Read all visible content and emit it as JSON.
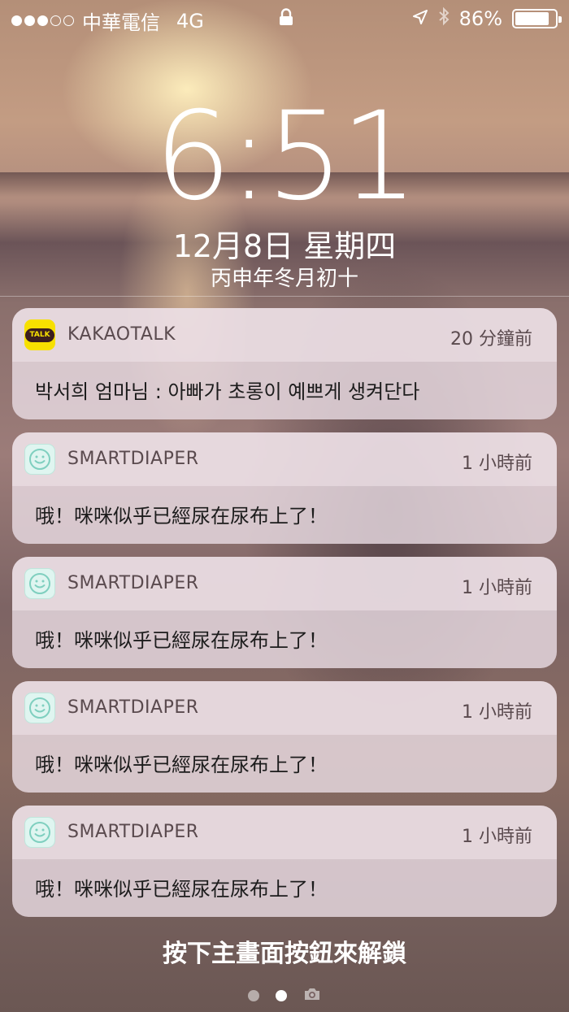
{
  "status_bar": {
    "signal_dots": 5,
    "signal_filled": 3,
    "carrier": "中華電信",
    "network": "4G",
    "battery_percent": "86%",
    "battery_level": 0.86
  },
  "lock_screen": {
    "time": "6:51",
    "date": "12月8日 星期四",
    "lunar_date": "丙申年冬月初十",
    "unlock_hint": "按下主畫面按鈕來解鎖"
  },
  "notifications": [
    {
      "app": "KAKAOTALK",
      "icon": "kakaotalk-icon",
      "icon_text": "TALK",
      "time": "20 分鐘前",
      "message": "박서희 엄마님 : 아빠가 초롱이 예쁘게 생켜단다"
    },
    {
      "app": "SMARTDIAPER",
      "icon": "smiley-icon",
      "time": "1 小時前",
      "message": "哦！咪咪似乎已經尿在尿布上了！"
    },
    {
      "app": "SMARTDIAPER",
      "icon": "smiley-icon",
      "time": "1 小時前",
      "message": "哦！咪咪似乎已經尿在尿布上了！"
    },
    {
      "app": "SMARTDIAPER",
      "icon": "smiley-icon",
      "time": "1 小時前",
      "message": "哦！咪咪似乎已經尿在尿布上了！"
    },
    {
      "app": "SMARTDIAPER",
      "icon": "smiley-icon",
      "time": "1 小時前",
      "message": "哦！咪咪似乎已經尿在尿布上了！"
    }
  ],
  "pager": {
    "pages": 2,
    "current": 1,
    "extra_icon": "camera-icon"
  },
  "colors": {
    "kakao_yellow": "#f7e000",
    "notification_bg": "#e8dae2"
  }
}
